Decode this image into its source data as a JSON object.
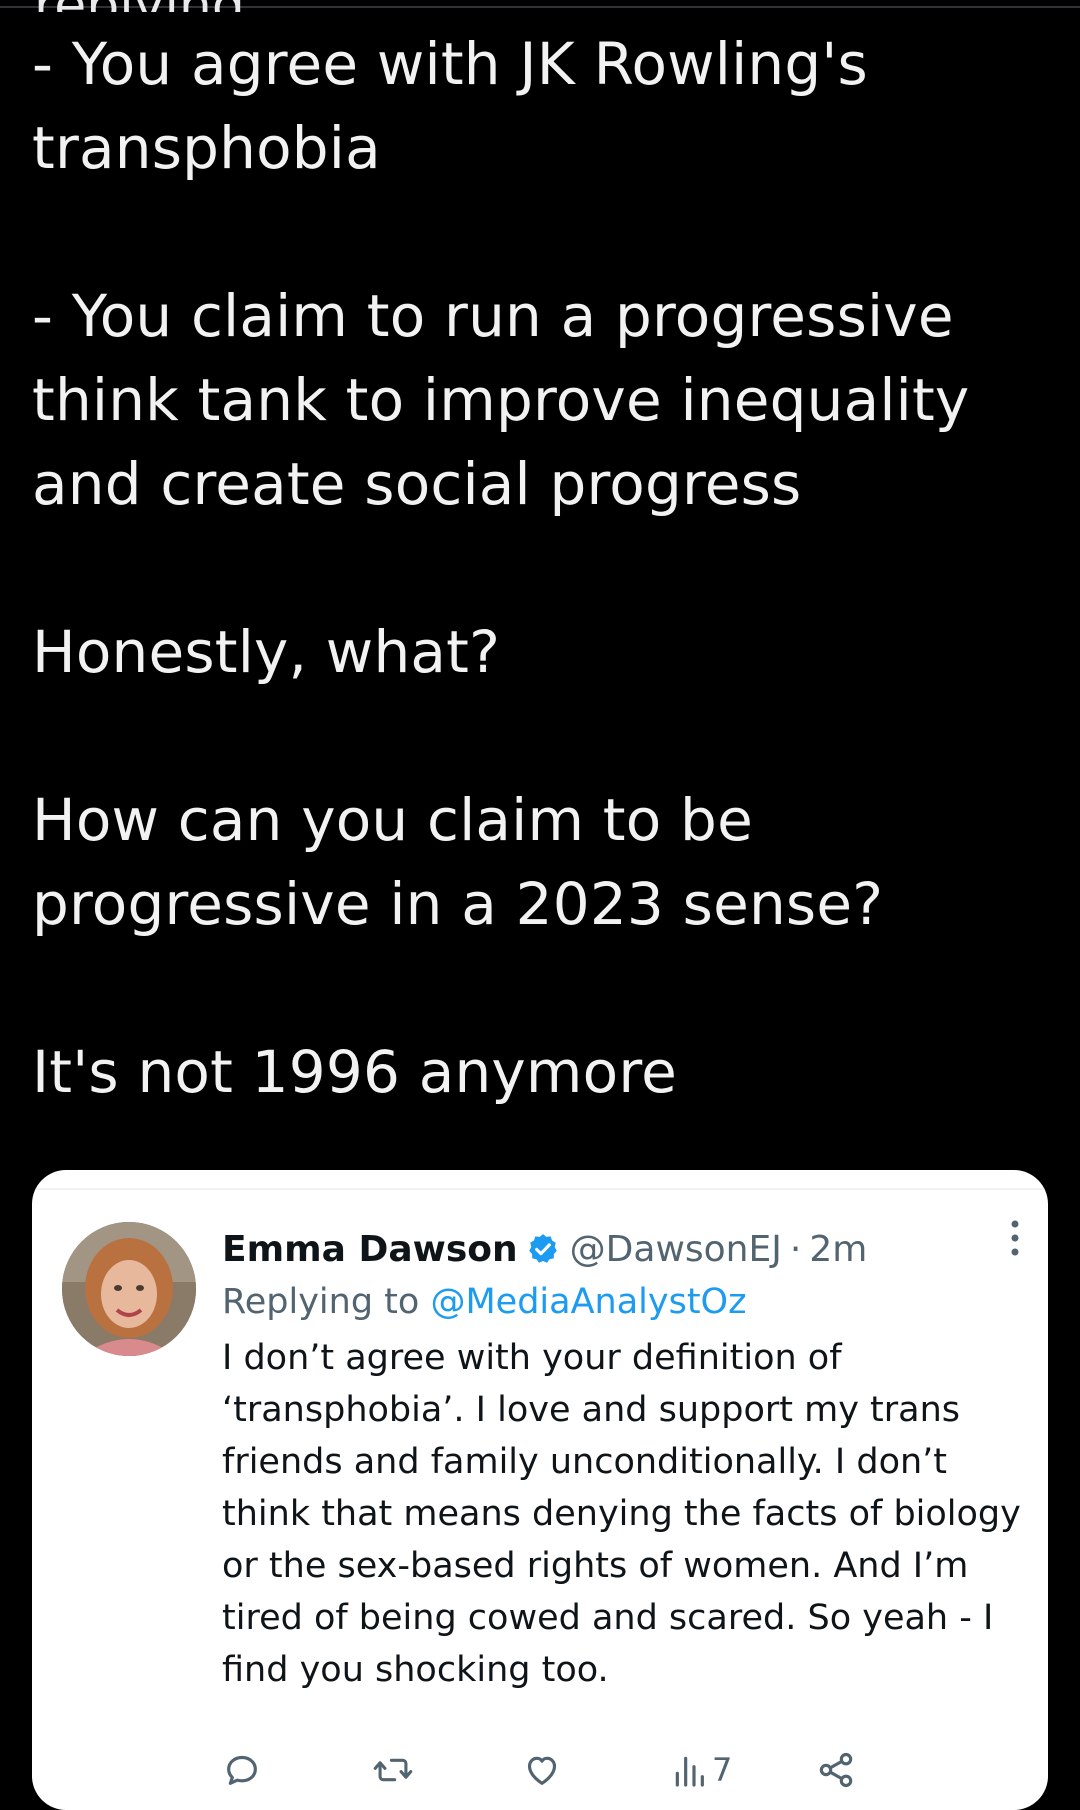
{
  "tweet": {
    "cut_line": "replying",
    "paragraphs": [
      "- You agree with JK Rowling's transphobia",
      "- You claim to run a progressive think tank to improve inequality and create social progress",
      "Honestly, what?",
      "How can you claim to be progressive in a 2023 sense?",
      "It's not 1996 anymore"
    ]
  },
  "quoted_tweet": {
    "author_name": "Emma Dawson",
    "verified_icon": "verified-badge-icon",
    "handle": "@DawsonEJ",
    "separator": "·",
    "time": "2m",
    "replying_prefix": "Replying to",
    "replying_to": "@MediaAnalystOz",
    "body": "I don’t agree with your definition of ‘transphobia’. I love and support my trans friends and family unconditionally. I don’t think that means denying the facts of biology or the sex-based rights of women. And I’m tired of being cowed and scared. So yeah - I find you shocking too.",
    "views": "7",
    "icons": {
      "reply": "reply-icon",
      "retweet": "retweet-icon",
      "like": "heart-icon",
      "views": "views-bar-chart-icon",
      "share": "share-icon",
      "more": "more-vertical-icon"
    }
  },
  "colors": {
    "background": "#000000",
    "text_main": "#f2f2f2",
    "card_bg": "#ffffff",
    "text_dark": "#0f1419",
    "text_muted": "#536471",
    "accent_blue": "#1d9bf0"
  }
}
